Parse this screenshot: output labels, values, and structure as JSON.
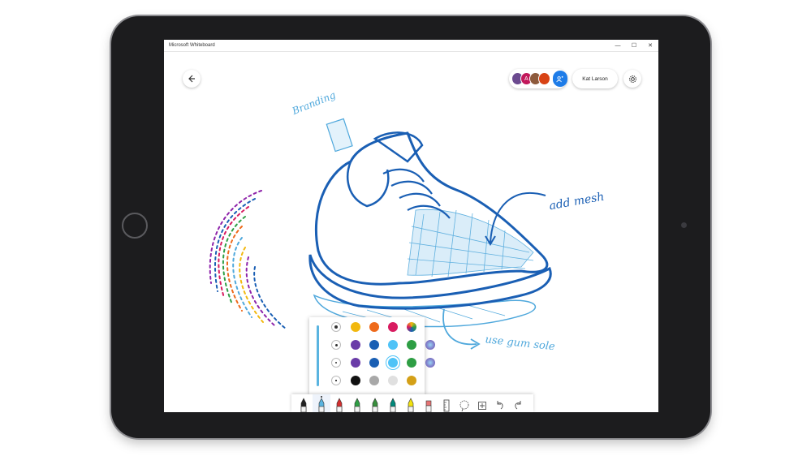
{
  "app": {
    "title": "Microsoft Whiteboard"
  },
  "window_controls": {
    "minimize": "—",
    "maximize": "☐",
    "close": "✕"
  },
  "user": {
    "name": "Kat Larson"
  },
  "collaborators": [
    {
      "initial": "",
      "color": "#6b4a8f"
    },
    {
      "initial": "A",
      "color": "#c2185b"
    },
    {
      "initial": "",
      "color": "#8d5a3c"
    },
    {
      "initial": "",
      "color": "#d84315"
    }
  ],
  "canvas_annotations": {
    "branding": "Branding",
    "add_mesh": "add mesh",
    "gum_sole": "use gum sole"
  },
  "colors": {
    "ink_dark_blue": "#1a5fb4",
    "ink_light_blue": "#4fa8dc",
    "accent": "#1e7ce8"
  },
  "palette": {
    "rows": [
      [
        "#f2b80e",
        "#ee6a1b",
        "#d81b60",
        "#rainbow"
      ],
      [
        "#6a3ca8",
        "#1a5fb4",
        "#4fc3f7",
        "#2e9e44",
        "#galaxy"
      ],
      [
        "#111111",
        "#a8a8a8",
        "#e0e0e0",
        "#d4a017"
      ]
    ]
  },
  "tools": [
    {
      "name": "pen-black",
      "color": "#222222"
    },
    {
      "name": "pen-blue",
      "color": "#5ab4e0",
      "active": true
    },
    {
      "name": "pen-red",
      "color": "#d32f2f"
    },
    {
      "name": "pen-green",
      "color": "#2e9e44"
    },
    {
      "name": "pen-green-2",
      "color": "#388e3c"
    },
    {
      "name": "pen-teal",
      "color": "#00897b"
    },
    {
      "name": "highlighter-yellow",
      "color": "#f2e20e"
    },
    {
      "name": "eraser",
      "color": "#e57373"
    },
    {
      "name": "ruler",
      "color": "#888888"
    },
    {
      "name": "lasso",
      "color": "#888888"
    },
    {
      "name": "add",
      "color": "#555555"
    },
    {
      "name": "undo",
      "color": "#555555"
    },
    {
      "name": "redo",
      "color": "#555555"
    }
  ]
}
